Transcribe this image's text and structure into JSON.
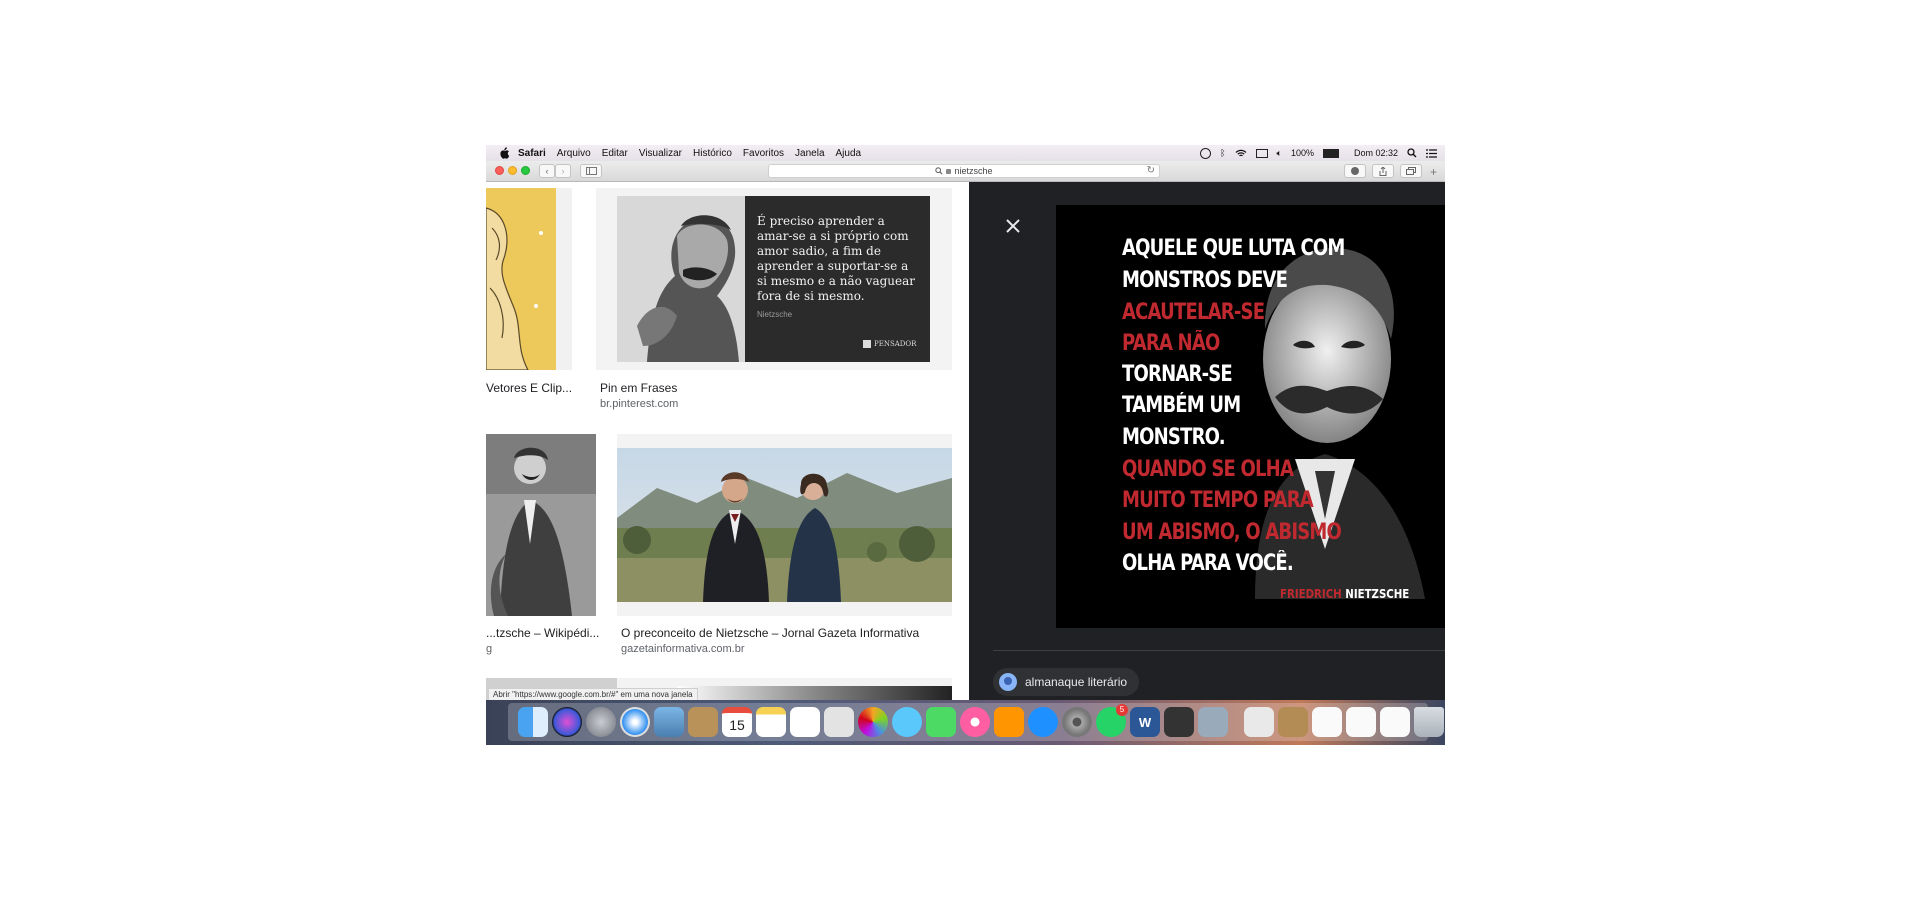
{
  "menubar": {
    "app": "Safari",
    "items": [
      "Arquivo",
      "Editar",
      "Visualizar",
      "Histórico",
      "Favoritos",
      "Janela",
      "Ajuda"
    ],
    "battery": "100%",
    "clock": "Dom 02:32"
  },
  "toolbar": {
    "address": "nietzsche"
  },
  "results": {
    "left_col": [
      {
        "title": "Vetores E Clip...",
        "site": ""
      },
      {
        "title": "...tzsche – Wikipédi...",
        "site": "g"
      }
    ],
    "right_col": [
      {
        "title": "Pin em Frases",
        "site": "br.pinterest.com"
      },
      {
        "title": "O preconceito de Nietzsche – Jornal Gazeta Informativa",
        "site": "gazetainformativa.com.br"
      }
    ]
  },
  "quote_card": {
    "lines": [
      "É preciso aprender a",
      "amar-se a si próprio com",
      "amor sadio, a fim de",
      "aprender a suportar-se a",
      "si mesmo e a não vaguear",
      "fora de si mesmo."
    ],
    "author": "Nietzsche",
    "brand": "PENSADOR"
  },
  "preview": {
    "quote_lines": [
      {
        "text": "Aquele que luta com",
        "color": "#ffffff"
      },
      {
        "text": "monstros deve",
        "color": "#ffffff"
      },
      {
        "text": "acautelar-se",
        "color": "#c0292f"
      },
      {
        "text": "para não",
        "color": "#c0292f"
      },
      {
        "text": "tornar-se",
        "color": "#ffffff"
      },
      {
        "text": "também um",
        "color": "#ffffff"
      },
      {
        "text": "monstro.",
        "color": "#ffffff"
      },
      {
        "text": "Quando se olha",
        "color": "#c0292f"
      },
      {
        "text": "muito tempo para",
        "color": "#c0292f"
      },
      {
        "text": "um abismo, o abismo",
        "color": "#c0292f"
      },
      {
        "text": "olha para você.",
        "color": "#ffffff"
      }
    ],
    "signature_first": "FRIEDRICH",
    "signature_last": "NIETZSCHE",
    "source_chip": "almanaque literário"
  },
  "statusbar": "Abrir \"https://www.google.com.br/#\" em uma nova janela",
  "dock": {
    "calendar_day": "15",
    "badge": "5",
    "word_letter": "W"
  }
}
